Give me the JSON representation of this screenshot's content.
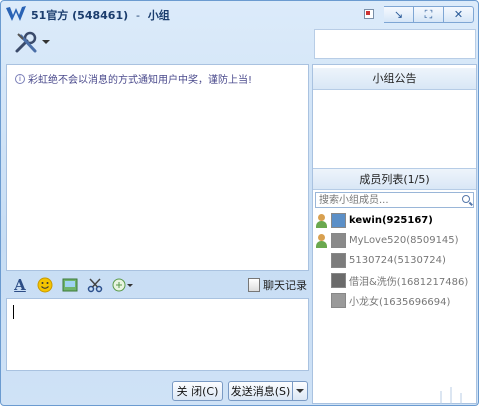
{
  "window": {
    "title_name": "51官方",
    "title_id": "(548461)",
    "title_separator": "-",
    "title_suffix": "小组"
  },
  "window_controls": {
    "skin": "skin-icon",
    "minimize": "↘",
    "maximize": "⛶",
    "close": "✕"
  },
  "chat": {
    "notice": "彩虹绝不会以消息的方式通知用户中奖，谨防上当!",
    "notice_icon": "i"
  },
  "toolbar": {
    "font_label": "A",
    "history_label": "聊天记录"
  },
  "buttons": {
    "close_label": "关 闭(C)",
    "send_label": "发送消息(S)"
  },
  "announcement": {
    "header": "小组公告"
  },
  "members": {
    "header": "成员列表(1/5)",
    "search_placeholder": "搜索小组成员...",
    "list": [
      {
        "name": "kewin(925167)",
        "status": "online",
        "avatar_color": "#5b8fc7"
      },
      {
        "name": "MyLove520(8509145)",
        "status": "offline",
        "avatar_color": "#8a8a8a"
      },
      {
        "name": "5130724(5130724)",
        "status": "offline",
        "avatar_color": "#7c7c7c"
      },
      {
        "name": "借泪&洗伤(1681217486)",
        "status": "offline",
        "avatar_color": "#6b6b6b"
      },
      {
        "name": "小龙女(1635696694)",
        "status": "offline",
        "avatar_color": "#9a9a9a"
      }
    ]
  },
  "colors": {
    "window_bg": "#c7ddf4",
    "accent": "#2a5a98"
  }
}
